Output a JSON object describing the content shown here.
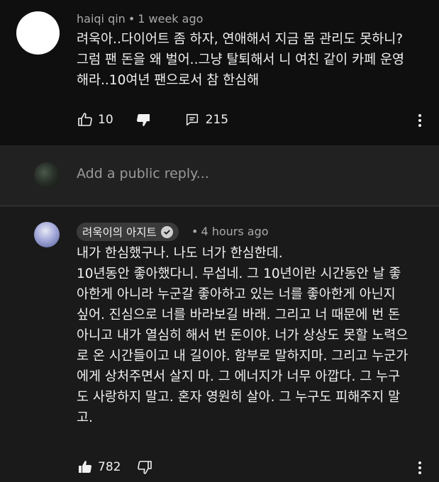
{
  "comment": {
    "author": "haiqi qin",
    "time": "1 week ago",
    "text": "려욱아..다이어트 좀 하자, 연애해서 지금 몸 관리도 못하니?\n그럼 팬 돈을 왜 벌어..그냥 탈퇴해서 니 여친 같이 카페 운영\n해라..10여년 팬으로서 참 한심해",
    "likes": "10",
    "replies": "215"
  },
  "reply_box": {
    "placeholder": "Add a public reply..."
  },
  "reply": {
    "author": "려욱이의 아지트",
    "time": "4 hours ago",
    "text": "내가 한심했구나. 나도 너가 한심한데.\n10년동안 좋아했다니. 무섭네. 그 10년이란 시간동안 날 좋\n아한게 아니라 누군갈 좋아하고 있는 너를 좋아한게 아닌지\n싶어. 진심으로 너를 바라보길 바래. 그리고 너 때문에 번 돈\n아니고 내가 열심히 해서 번 돈이야. 너가 상상도 못할 노력으\n로 온 시간들이고 내 길이야. 함부로 말하지마. 그리고 누군가\n에게 상처주면서 살지 마. 그 에너지가 너무 아깝다. 그 누구\n도 사랑하지 말고. 혼자 영원히 살아. 그 누구도 피해주지 말\n고.",
    "likes": "782"
  },
  "icons": {
    "like": "thumbs-up-icon",
    "dislike": "thumbs-down-icon",
    "replies": "comment-icon",
    "menu": "more-vert-icon",
    "verified": "check-icon"
  }
}
